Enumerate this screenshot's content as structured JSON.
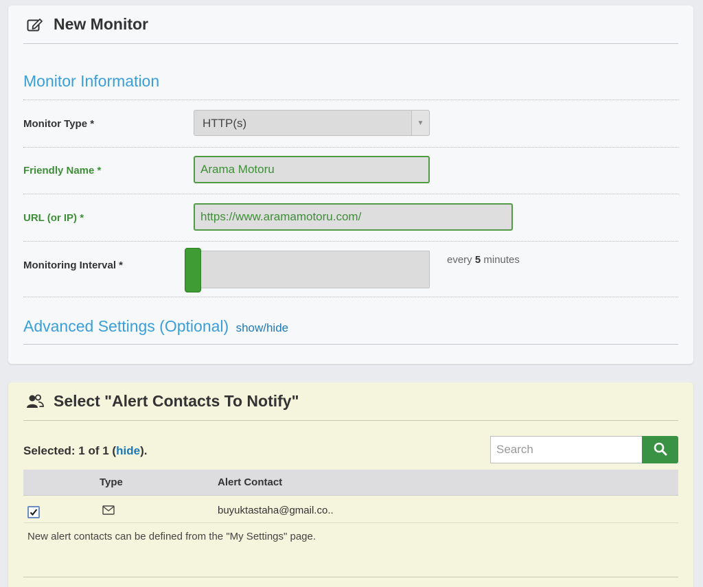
{
  "monitor_panel": {
    "title": "New Monitor",
    "section_title": "Monitor Information",
    "fields": {
      "monitor_type": {
        "label": "Monitor Type *",
        "value": "HTTP(s)"
      },
      "friendly_name": {
        "label": "Friendly Name *",
        "value": "Arama Motoru"
      },
      "url": {
        "label": "URL (or IP) *",
        "value": "https://www.aramamotoru.com/"
      },
      "interval": {
        "label": "Monitoring Interval *",
        "prefix": "every",
        "value": "5",
        "suffix": "minutes",
        "slider_level": 0
      }
    },
    "advanced": {
      "title": "Advanced Settings (Optional)",
      "toggle": "show/hide"
    }
  },
  "alerts_panel": {
    "title": "Select \"Alert Contacts To Notify\"",
    "selected_prefix": "Selected: 1 of 1 (",
    "selected_link": "hide",
    "selected_suffix": ").",
    "search": {
      "placeholder": "Search"
    },
    "table": {
      "headers": {
        "type": "Type",
        "contact": "Alert Contact"
      },
      "rows": [
        {
          "checked": true,
          "type_icon": "envelope-icon",
          "contact": "buyuktastaha@gmail.co.."
        }
      ]
    },
    "note": "New alert contacts can be defined from the \"My Settings\" page."
  },
  "colors": {
    "accent_blue": "#3a9fd8",
    "valid_green": "#3e8e38",
    "search_button": "#3a9245",
    "alerts_background": "#f5f4dc"
  }
}
